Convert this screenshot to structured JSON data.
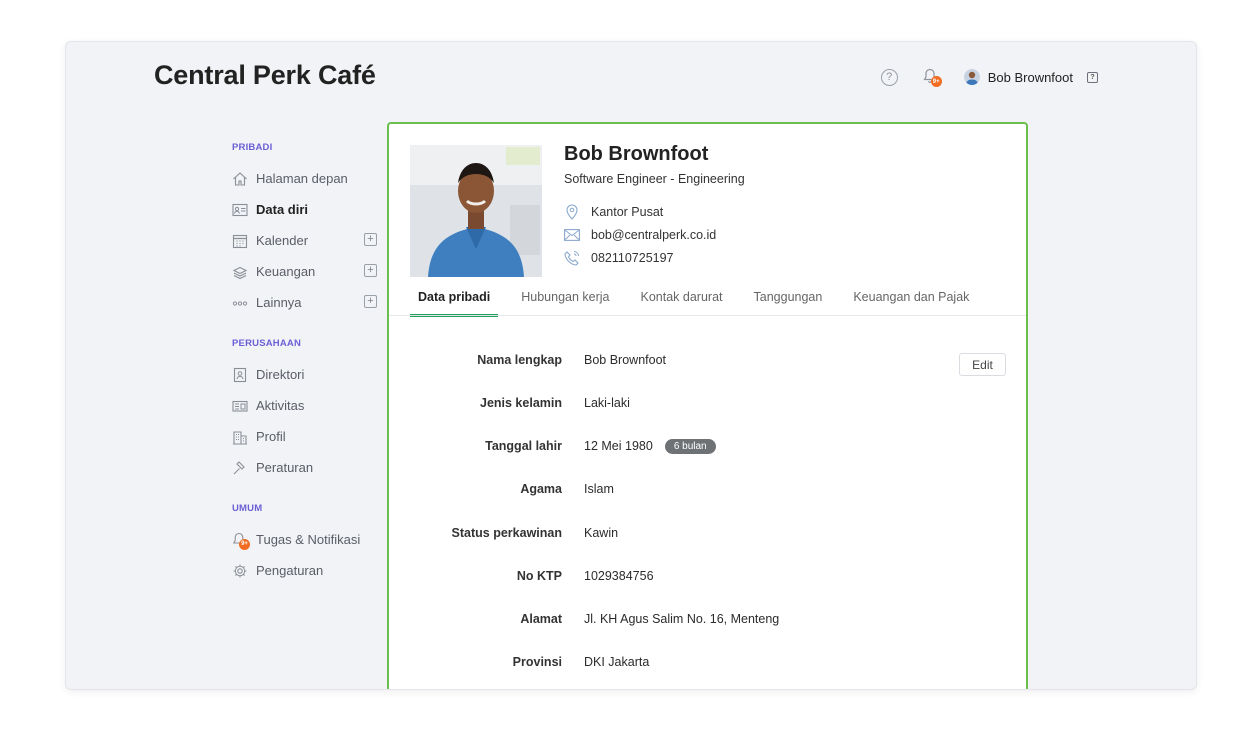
{
  "app": {
    "title": "Central Perk Café"
  },
  "topbar": {
    "help_icon": "help-circle-icon",
    "notif_badge": "9+",
    "user_name": "Bob Brownfoot",
    "dropdown_icon": "?"
  },
  "sidebar": {
    "sections": [
      {
        "label": "PRIBADI",
        "items": [
          {
            "label": "Halaman depan",
            "icon": "home-icon"
          },
          {
            "label": "Data diri",
            "icon": "id-card-icon",
            "active": true
          },
          {
            "label": "Kalender",
            "icon": "calendar-icon",
            "expandable": true
          },
          {
            "label": "Keuangan",
            "icon": "money-icon",
            "expandable": true
          },
          {
            "label": "Lainnya",
            "icon": "more-icon",
            "expandable": true
          }
        ]
      },
      {
        "label": "PERUSAHAAN",
        "items": [
          {
            "label": "Direktori",
            "icon": "directory-icon"
          },
          {
            "label": "Aktivitas",
            "icon": "activity-icon"
          },
          {
            "label": "Profil",
            "icon": "building-icon"
          },
          {
            "label": "Peraturan",
            "icon": "gavel-icon"
          }
        ]
      },
      {
        "label": "UMUM",
        "items": [
          {
            "label": "Tugas & Notifikasi",
            "icon": "bell-badge-icon"
          },
          {
            "label": "Pengaturan",
            "icon": "gear-icon"
          }
        ]
      }
    ],
    "plus": "+",
    "task_badge": "9+"
  },
  "profile": {
    "name": "Bob Brownfoot",
    "title": "Software Engineer - Engineering",
    "location": "Kantor Pusat",
    "email": "bob@centralperk.co.id",
    "phone": "082110725197"
  },
  "tabs": [
    "Data pribadi",
    "Hubungan kerja",
    "Kontak darurat",
    "Tanggungan",
    "Keuangan dan Pajak"
  ],
  "edit_label": "Edit",
  "fields": [
    {
      "label": "Nama lengkap",
      "value": "Bob Brownfoot"
    },
    {
      "label": "Jenis kelamin",
      "value": "Laki-laki"
    },
    {
      "label": "Tanggal lahir",
      "value": "12 Mei 1980",
      "badge": "6 bulan"
    },
    {
      "label": "Agama",
      "value": "Islam"
    },
    {
      "label": "Status perkawinan",
      "value": "Kawin"
    },
    {
      "label": "No KTP",
      "value": "1029384756"
    },
    {
      "label": "Alamat",
      "value": "Jl. KH Agus Salim No. 16, Menteng"
    },
    {
      "label": "Provinsi",
      "value": "DKI Jakarta"
    }
  ],
  "colors": {
    "accent_green": "#1f9f5a",
    "card_border": "#6bbf4e",
    "section_label": "#6b5fd6",
    "badge_orange": "#f26d21"
  }
}
